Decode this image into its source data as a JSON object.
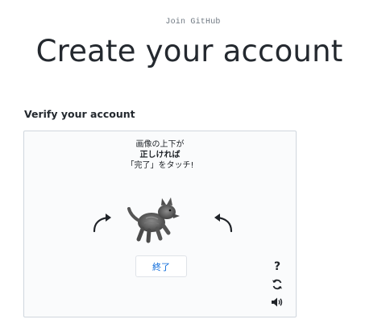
{
  "header": {
    "kicker": "Join GitHub",
    "title": "Create your account"
  },
  "verify": {
    "label": "Verify your account"
  },
  "captcha": {
    "instruction_line1": "画像の上下が",
    "instruction_line2": "正しければ",
    "instruction_line3": "「完了」をタッチ!",
    "done_label": "終了",
    "help_label": "?",
    "icons": {
      "rotate_left": "rotate-left-arrow",
      "rotate_right": "rotate-right-arrow",
      "animal": "dog-image",
      "refresh": "refresh-icon",
      "audio": "speaker-icon"
    }
  },
  "colors": {
    "text": "#24292f",
    "muted": "#6e7781",
    "border": "#d0d7de",
    "link": "#0969da"
  }
}
